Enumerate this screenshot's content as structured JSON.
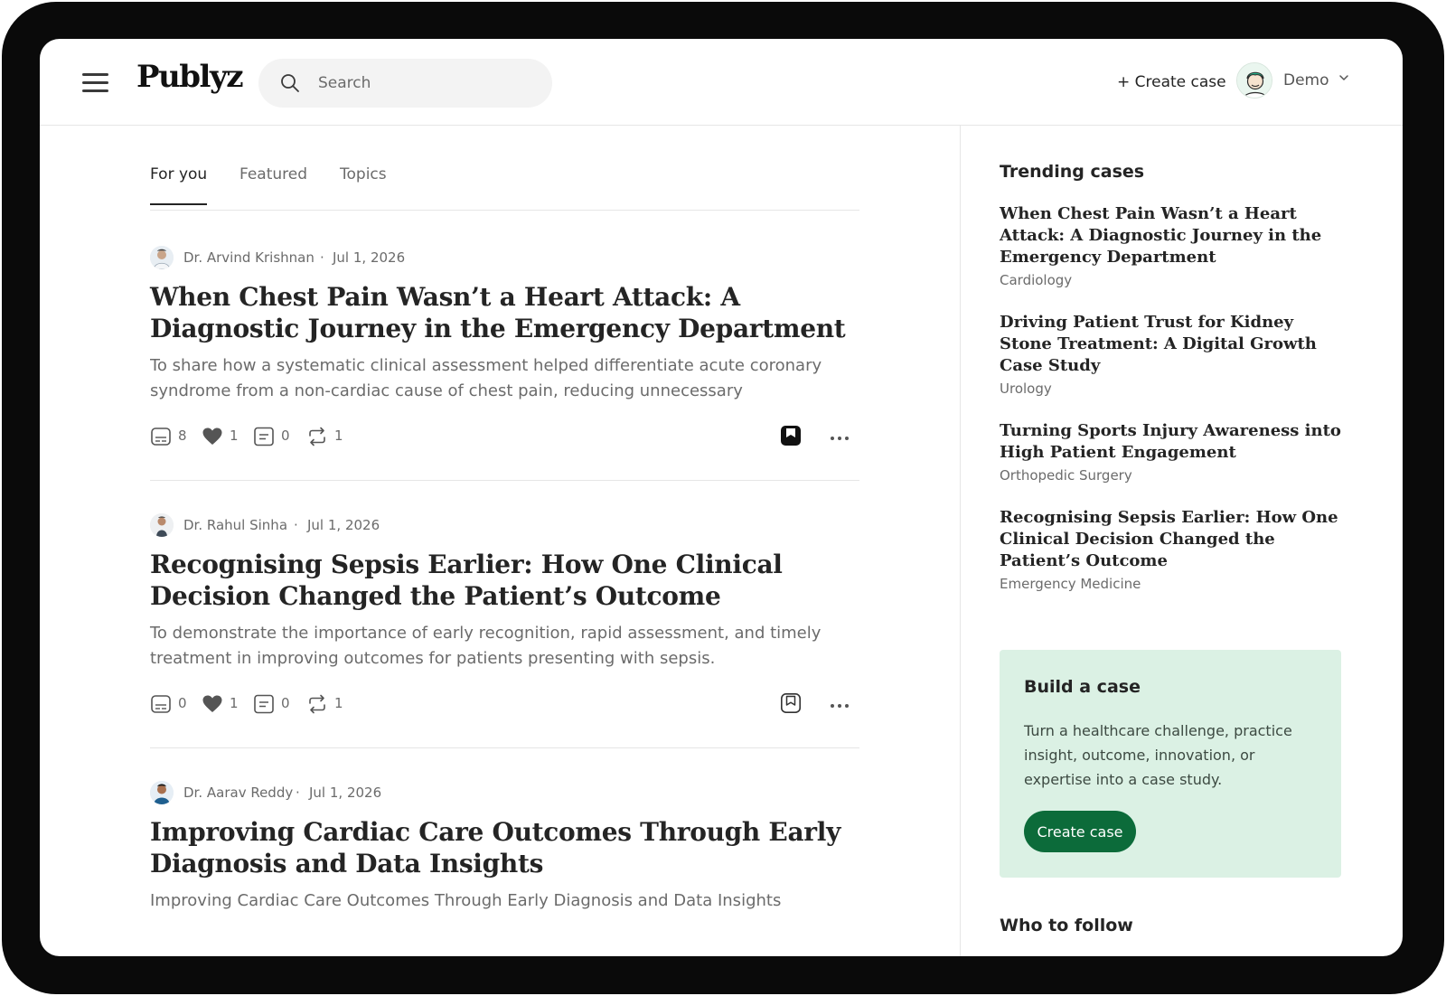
{
  "app": {
    "logo": "Publyz"
  },
  "header": {
    "search_placeholder": "Search",
    "create_case_label": "+ Create case",
    "user_name": "Demo",
    "icons": {
      "menu": "hamburger-icon",
      "search": "search-icon",
      "chevron": "chevron-down-icon"
    }
  },
  "tabs": [
    {
      "label": "For you",
      "active": true
    },
    {
      "label": "Featured",
      "active": false
    },
    {
      "label": "Topics",
      "active": false
    }
  ],
  "posts": [
    {
      "author": "Dr. Arvind Krishnan",
      "separator": "·",
      "date": "Jul 1, 2026",
      "title": "When Chest Pain Wasn’t a Heart Attack: A Diagnostic Journey in the Emergency Department",
      "summary": "To share how a systematic clinical assessment helped differentiate acute coronary syndrome from a non-cardiac cause of chest pain, reducing unnecessary intervention…",
      "stats": {
        "views": "8",
        "likes": "1",
        "comments": "0",
        "reposts": "1"
      },
      "bookmarked": true
    },
    {
      "author": "Dr. Rahul Sinha",
      "separator": "·",
      "date": "Jul 1, 2026",
      "title": "Recognising Sepsis Earlier: How One Clinical Decision Changed the Patient’s Outcome",
      "summary": "To demonstrate the importance of early recognition, rapid assessment, and timely treatment in improving outcomes for patients presenting with sepsis.",
      "stats": {
        "views": "0",
        "likes": "1",
        "comments": "0",
        "reposts": "1"
      },
      "bookmarked": false
    },
    {
      "author": "Dr. Aarav Reddy",
      "separator": "·",
      "date": "Jul 1, 2026",
      "title": "Improving Cardiac Care Outcomes Through Early Diagnosis and Data Insights",
      "summary": "Improving Cardiac Care Outcomes Through Early Diagnosis and Data Insights"
    }
  ],
  "sidebar": {
    "trending_heading": "Trending cases",
    "trending": [
      {
        "title": "When Chest Pain Wasn’t a Heart Attack: A Diagnostic Journey in the Emergency Department",
        "category": "Cardiology"
      },
      {
        "title": "Driving Patient Trust for Kidney Stone Treatment: A Digital Growth Case Study",
        "category": "Urology"
      },
      {
        "title": "Turning Sports Injury Awareness into High Patient Engagement",
        "category": "Orthopedic Surgery"
      },
      {
        "title": "Recognising Sepsis Earlier: How One Clinical Decision Changed the Patient’s Outcome",
        "category": "Emergency Medicine"
      }
    ],
    "build_case": {
      "title": "Build a case",
      "text": "Turn a healthcare challenge, practice insight, outcome, innovation, or expertise into a case study.",
      "button_label": "Create case"
    },
    "who_to_follow_heading": "Who to follow"
  },
  "colors": {
    "accent": "#0c6b3a",
    "card_bg": "#dbf1e4",
    "text": "#242424",
    "muted": "#6b6b6b"
  }
}
